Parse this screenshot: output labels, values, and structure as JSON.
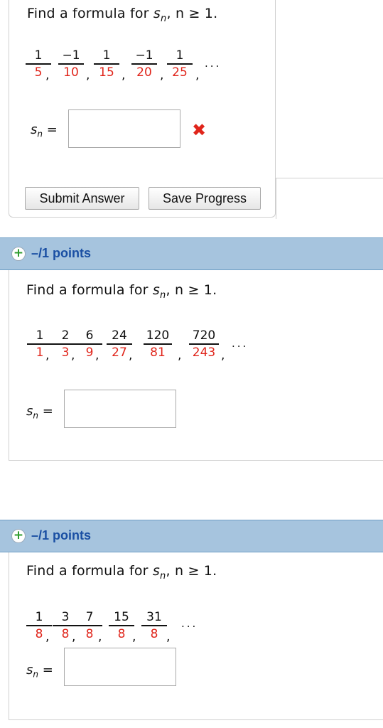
{
  "questions": [
    {
      "prompt_text": "Find a formula for ",
      "prompt_var": "s",
      "prompt_sub": "n",
      "prompt_tail": ", n ≥ 1.",
      "sequence": [
        {
          "num": "1",
          "den": "5"
        },
        {
          "num": "−1",
          "den": "10"
        },
        {
          "num": "1",
          "den": "15"
        },
        {
          "num": "−1",
          "den": "20"
        },
        {
          "num": "1",
          "den": "25"
        }
      ],
      "ellipsis": "...",
      "answer_label_var": "s",
      "answer_label_sub": "n",
      "answer_label_eq": " =",
      "answer_value": "",
      "error_mark": "✖",
      "buttons": {
        "submit": "Submit Answer",
        "save": "Save Progress"
      }
    },
    {
      "points_label": "–/1 points",
      "plus": "+",
      "prompt_text": "Find a formula for ",
      "prompt_var": "s",
      "prompt_sub": "n",
      "prompt_tail": ", n ≥ 1.",
      "sequence": [
        {
          "num": "1",
          "den": "1"
        },
        {
          "num": "2",
          "den": "3"
        },
        {
          "num": "6",
          "den": "9"
        },
        {
          "num": "24",
          "den": "27"
        },
        {
          "num": "120",
          "den": "81"
        },
        {
          "num": "720",
          "den": "243"
        }
      ],
      "ellipsis": "...",
      "answer_label_var": "s",
      "answer_label_sub": "n",
      "answer_label_eq": " =",
      "answer_value": ""
    },
    {
      "points_label": "–/1 points",
      "plus": "+",
      "prompt_text": "Find a formula for ",
      "prompt_var": "s",
      "prompt_sub": "n",
      "prompt_tail": ", n ≥ 1.",
      "sequence": [
        {
          "num": "1",
          "den": "8"
        },
        {
          "num": "3",
          "den": "8"
        },
        {
          "num": "7",
          "den": "8"
        },
        {
          "num": "15",
          "den": "8"
        },
        {
          "num": "31",
          "den": "8"
        }
      ],
      "ellipsis": "...",
      "answer_label_var": "s",
      "answer_label_sub": "n",
      "answer_label_eq": " =",
      "answer_value": ""
    }
  ],
  "colors": {
    "header_bg": "#a6c4de",
    "points_text": "#1a4fa3",
    "denominator": "#e0251b",
    "error": "#e0251b",
    "plus_icon": "#2e9b2e"
  }
}
